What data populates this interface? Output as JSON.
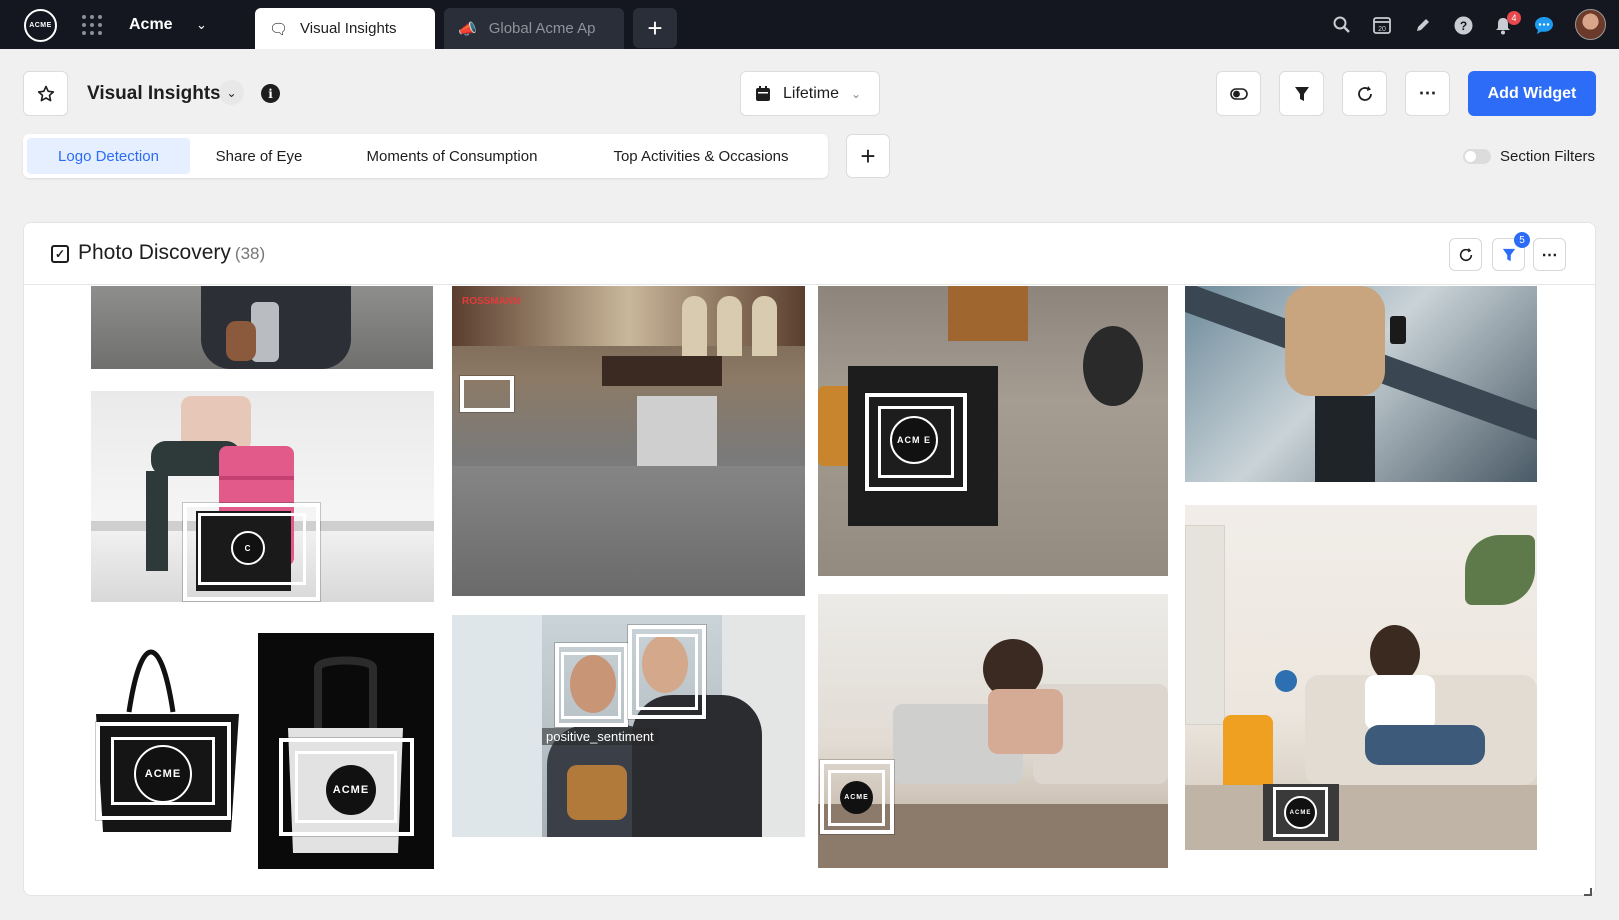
{
  "topbar": {
    "logo_text": "ACME",
    "brand": "Acme",
    "tabs": [
      {
        "label": "Visual Insights",
        "active": true
      },
      {
        "label": "Global Acme Ap",
        "active": false
      }
    ],
    "icons": [
      "search-icon",
      "calendar-icon",
      "pencil-icon",
      "help-icon",
      "bell-icon",
      "chat-icon"
    ],
    "calendar_day": "20",
    "notification_count": "4"
  },
  "header": {
    "title": "Visual Insights",
    "date_range": "Lifetime",
    "add_widget_label": "Add Widget",
    "subtabs": [
      "Logo Detection",
      "Share of Eye",
      "Moments of Consumption",
      "Top Activities & Occasions"
    ],
    "active_subtab": "Logo Detection",
    "section_filters_label": "Section Filters",
    "section_filters_on": false
  },
  "panel": {
    "title": "Photo Discovery",
    "count": "(38)",
    "filter_badge": "5"
  },
  "photos": {
    "logo_text": "ACME",
    "partial_logo_1": "ACM E",
    "partial_logo_2": "C",
    "store_sign": "ROSSMANN",
    "sentiment_label": "positive_sentiment"
  },
  "colors": {
    "accent": "#2c6cf6",
    "topbar_bg": "#14171f",
    "badge_red": "#e5484d"
  }
}
